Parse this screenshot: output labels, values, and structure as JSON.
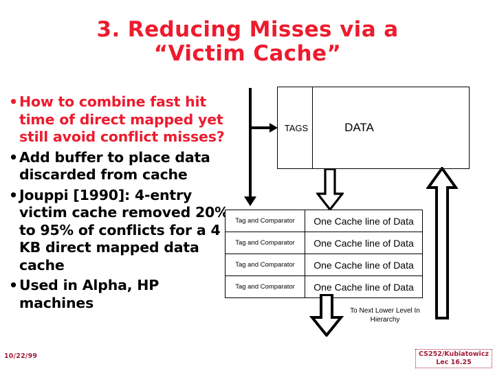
{
  "slide": {
    "title_line1": "3. Reducing Misses via a",
    "title_line2": "“Victim Cache”",
    "title_color": "#ED1B2E"
  },
  "bullets": [
    {
      "text": "How to combine fast hit time of direct mapped yet still avoid conflict misses?",
      "marker": "•",
      "color": "#ED1B2E"
    },
    {
      "text": "Add buffer to place data discarded from cache",
      "marker": "•",
      "color": "#000000"
    },
    {
      "text": "Jouppi [1990]: 4-entry victim cache removed 20% to 95% of conflicts for a 4 KB direct mapped data cache",
      "marker": "•",
      "color": "#000000"
    },
    {
      "text": "Used in Alpha, HP machines",
      "marker": "•",
      "color": "#000000"
    }
  ],
  "diagram": {
    "cache_box": {
      "tags_label": "TAGS",
      "data_label": "DATA"
    },
    "victim_rows": [
      {
        "tag": "Tag and Comparator",
        "data": "One Cache line of Data"
      },
      {
        "tag": "Tag and Comparator",
        "data": "One Cache line of Data"
      },
      {
        "tag": "Tag and Comparator",
        "data": "One Cache line of Data"
      },
      {
        "tag": "Tag and Comparator",
        "data": "One Cache line of Data"
      }
    ],
    "lower_level_label_line1": "To Next Lower Level In",
    "lower_level_label_line2": "Hierarchy"
  },
  "footer": {
    "date": "10/22/99",
    "credit_line1": "CS252/Kubiatowicz",
    "credit_line2": "Lec 16.25",
    "color": "#A21D3A"
  }
}
